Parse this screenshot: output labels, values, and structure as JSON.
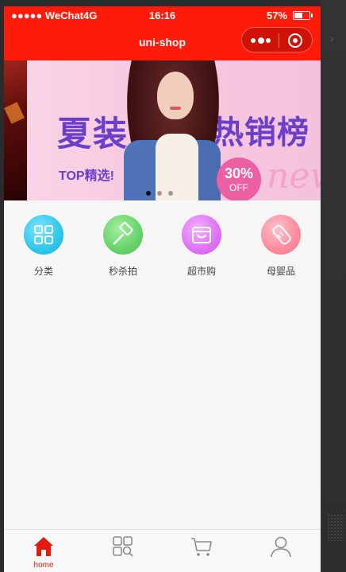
{
  "status_bar": {
    "carrier": "●●●●● WeChat4G",
    "time": "16:16",
    "battery": "57%"
  },
  "nav": {
    "title": "uni-shop"
  },
  "banner": {
    "left_text": "夏装",
    "right_text": "热销榜",
    "tagline": "TOP精选!",
    "discount": "30%",
    "discount_suffix": "OFF",
    "script_text": "new",
    "slide_count": 3,
    "active_slide": 0
  },
  "grid": [
    {
      "label": "分类",
      "icon": "category-grid-icon",
      "color": "#2ec6ec"
    },
    {
      "label": "秒杀拍",
      "icon": "hammer-icon",
      "color": "#66d36a"
    },
    {
      "label": "超市购",
      "icon": "store-icon",
      "color": "#df72f2"
    },
    {
      "label": "母婴品",
      "icon": "baby-bottle-icon",
      "color": "#ff8a9c"
    }
  ],
  "tabbar": {
    "items": [
      {
        "label": "home",
        "icon": "home-icon",
        "active": true
      },
      {
        "label": "",
        "icon": "category-icon",
        "active": false
      },
      {
        "label": "",
        "icon": "cart-icon",
        "active": false
      },
      {
        "label": "",
        "icon": "user-icon",
        "active": false
      }
    ]
  },
  "colors": {
    "brand_red": "#ff1b0a",
    "active_tab": "#e21a10"
  }
}
